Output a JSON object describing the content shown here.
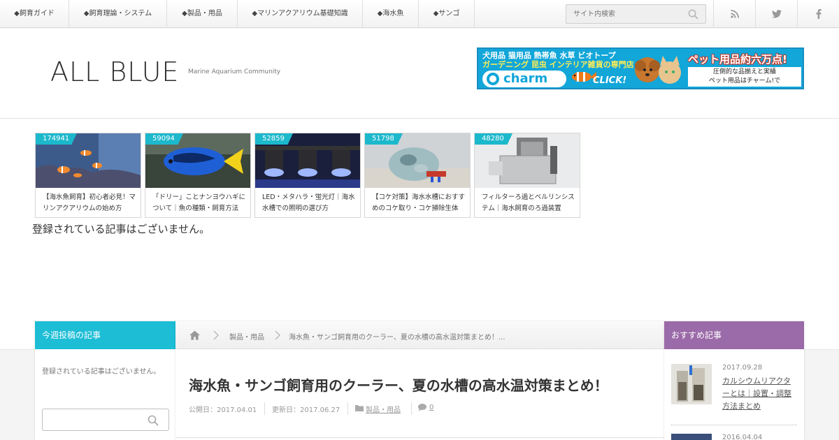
{
  "nav": {
    "items": [
      {
        "label": "◆飼育ガイド"
      },
      {
        "label": "◆飼育理論・システム"
      },
      {
        "label": "◆製品・用品"
      },
      {
        "label": "◆マリンアクアリウム基礎知識"
      },
      {
        "label": "◆海水魚"
      },
      {
        "label": "◆サンゴ"
      }
    ],
    "search_placeholder": "サイト内検索",
    "social": [
      "rss-icon",
      "twitter-icon",
      "facebook-icon"
    ]
  },
  "header": {
    "logo": "ALL BLUE",
    "tagline": "Marine Aquarium Community",
    "banner": {
      "line1": "犬用品 猫用品 熱帯魚 水草 ビオトープ",
      "line2": "ガーデニング 昆虫 インテリア雑貨の専門店",
      "brand": "charm",
      "click": "CLICK!",
      "headline": "ペット用品約六万点!",
      "sub1": "圧倒的な品揃えと実績",
      "sub2": "ペット用品はチャーム!で"
    }
  },
  "popular": [
    {
      "count": "174941",
      "title": "【海水魚飼育】初心者必見！マリンアクアリウムの始め方"
    },
    {
      "count": "59094",
      "title": "「ドリー」ことナンヨウハギについて｜魚の種類・飼育方法"
    },
    {
      "count": "52859",
      "title": "LED・メタハラ・蛍光灯｜海水水槽での照明の選び方"
    },
    {
      "count": "51798",
      "title": "【コケ対策】海水水槽におすすめのコケ取り・コケ掃除生体"
    },
    {
      "count": "48280",
      "title": "フィルターろ過とベルリンシステム｜海水飼育のろ過装置"
    }
  ],
  "no_articles_main": "登録されている記事はございません。",
  "left_sidebar": {
    "heading": "今週投稿の記事",
    "text": "登録されている記事はございません。",
    "search_placeholder": ""
  },
  "breadcrumb": {
    "items": [
      "製品・用品",
      "海水魚・サンゴ飼育用のクーラー、夏の水槽の高水温対策まとめ！..."
    ]
  },
  "post": {
    "title": "海水魚・サンゴ飼育用のクーラー、夏の水槽の高水温対策まとめ！",
    "published": "公開日：2017.04.01",
    "updated": "更新日：2017.06.27",
    "category": "製品・用品",
    "comments": "0"
  },
  "right_sidebar": {
    "heading": "おすすめ記事",
    "items": [
      {
        "date": "2017.09.28",
        "title": "カルシウムリアクターとは｜設置・調整方法まとめ"
      },
      {
        "date": "2016.04.04",
        "title": ""
      }
    ]
  },
  "colors": {
    "accent_cyan": "#1cbdd5",
    "accent_purple": "#9b6aa8",
    "banner_blue": "#12a6d9"
  }
}
